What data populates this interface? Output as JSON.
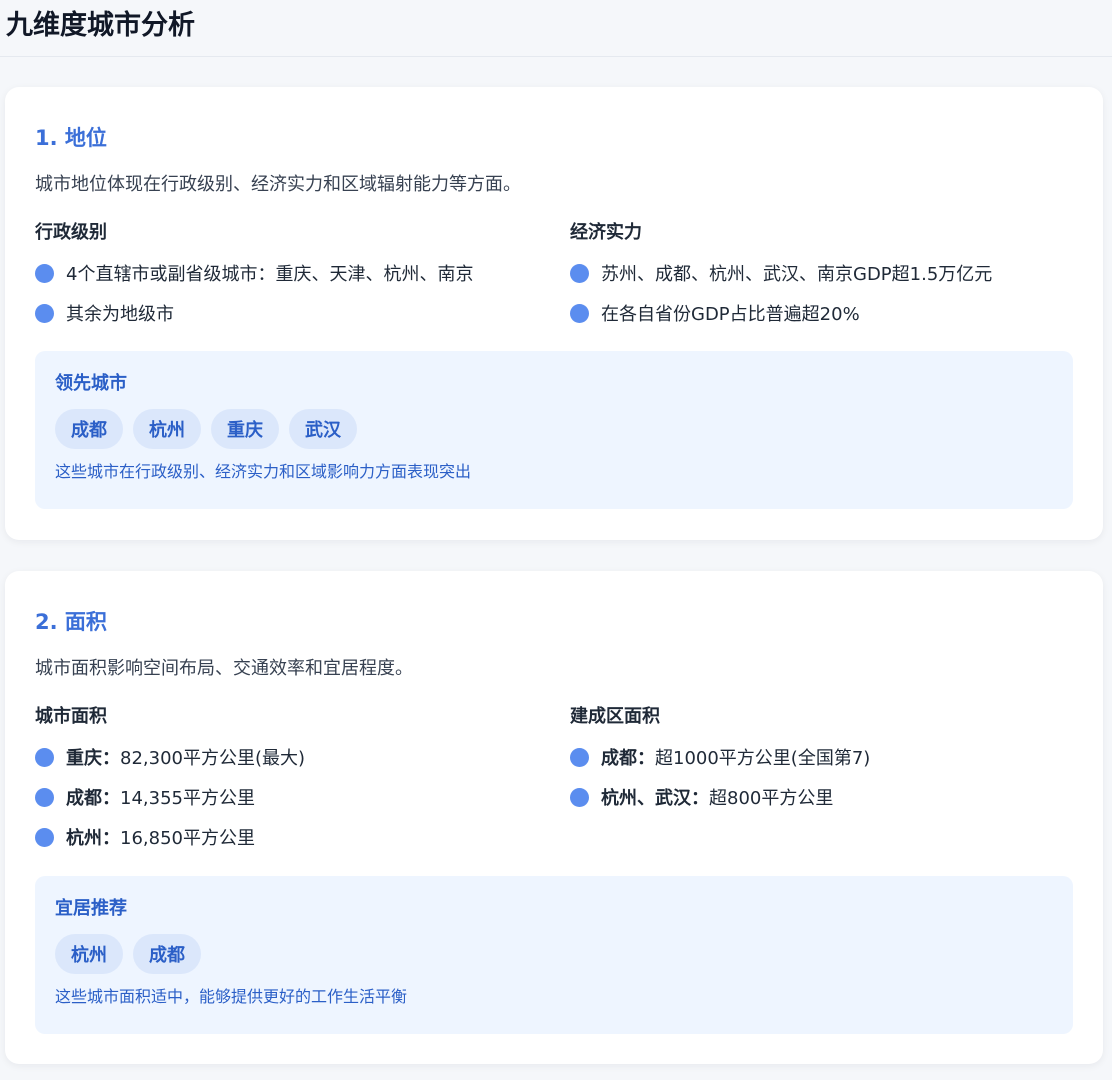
{
  "page": {
    "title": "九维度城市分析"
  },
  "sections": [
    {
      "title": "1. 地位",
      "description": "城市地位体现在行政级别、经济实力和区域辐射能力等方面。",
      "left": {
        "title": "行政级别",
        "items": [
          {
            "label": "",
            "text": "4个直辖市或副省级城市：重庆、天津、杭州、南京"
          },
          {
            "label": "",
            "text": "其余为地级市"
          }
        ]
      },
      "right": {
        "title": "经济实力",
        "items": [
          {
            "label": "",
            "text": "苏州、成都、杭州、武汉、南京GDP超1.5万亿元"
          },
          {
            "label": "",
            "text": "在各自省份GDP占比普遍超20%"
          }
        ]
      },
      "callout": {
        "title": "领先城市",
        "tags": [
          "成都",
          "杭州",
          "重庆",
          "武汉"
        ],
        "note": "这些城市在行政级别、经济实力和区域影响力方面表现突出"
      }
    },
    {
      "title": "2. 面积",
      "description": "城市面积影响空间布局、交通效率和宜居程度。",
      "left": {
        "title": "城市面积",
        "items": [
          {
            "label": "重庆：",
            "text": "82,300平方公里(最大)"
          },
          {
            "label": "成都：",
            "text": "14,355平方公里"
          },
          {
            "label": "杭州：",
            "text": "16,850平方公里"
          }
        ]
      },
      "right": {
        "title": "建成区面积",
        "items": [
          {
            "label": "成都：",
            "text": "超1000平方公里(全国第7)"
          },
          {
            "label": "杭州、武汉：",
            "text": "超800平方公里"
          }
        ]
      },
      "callout": {
        "title": "宜居推荐",
        "tags": [
          "杭州",
          "成都"
        ],
        "note": "这些城市面积适中，能够提供更好的工作生活平衡"
      }
    }
  ],
  "colors": {
    "accent": "#3b6fd8",
    "bullet_dot": "#5b8def",
    "callout_bg": "#eef5ff",
    "tag_bg": "#dbe7fb"
  }
}
